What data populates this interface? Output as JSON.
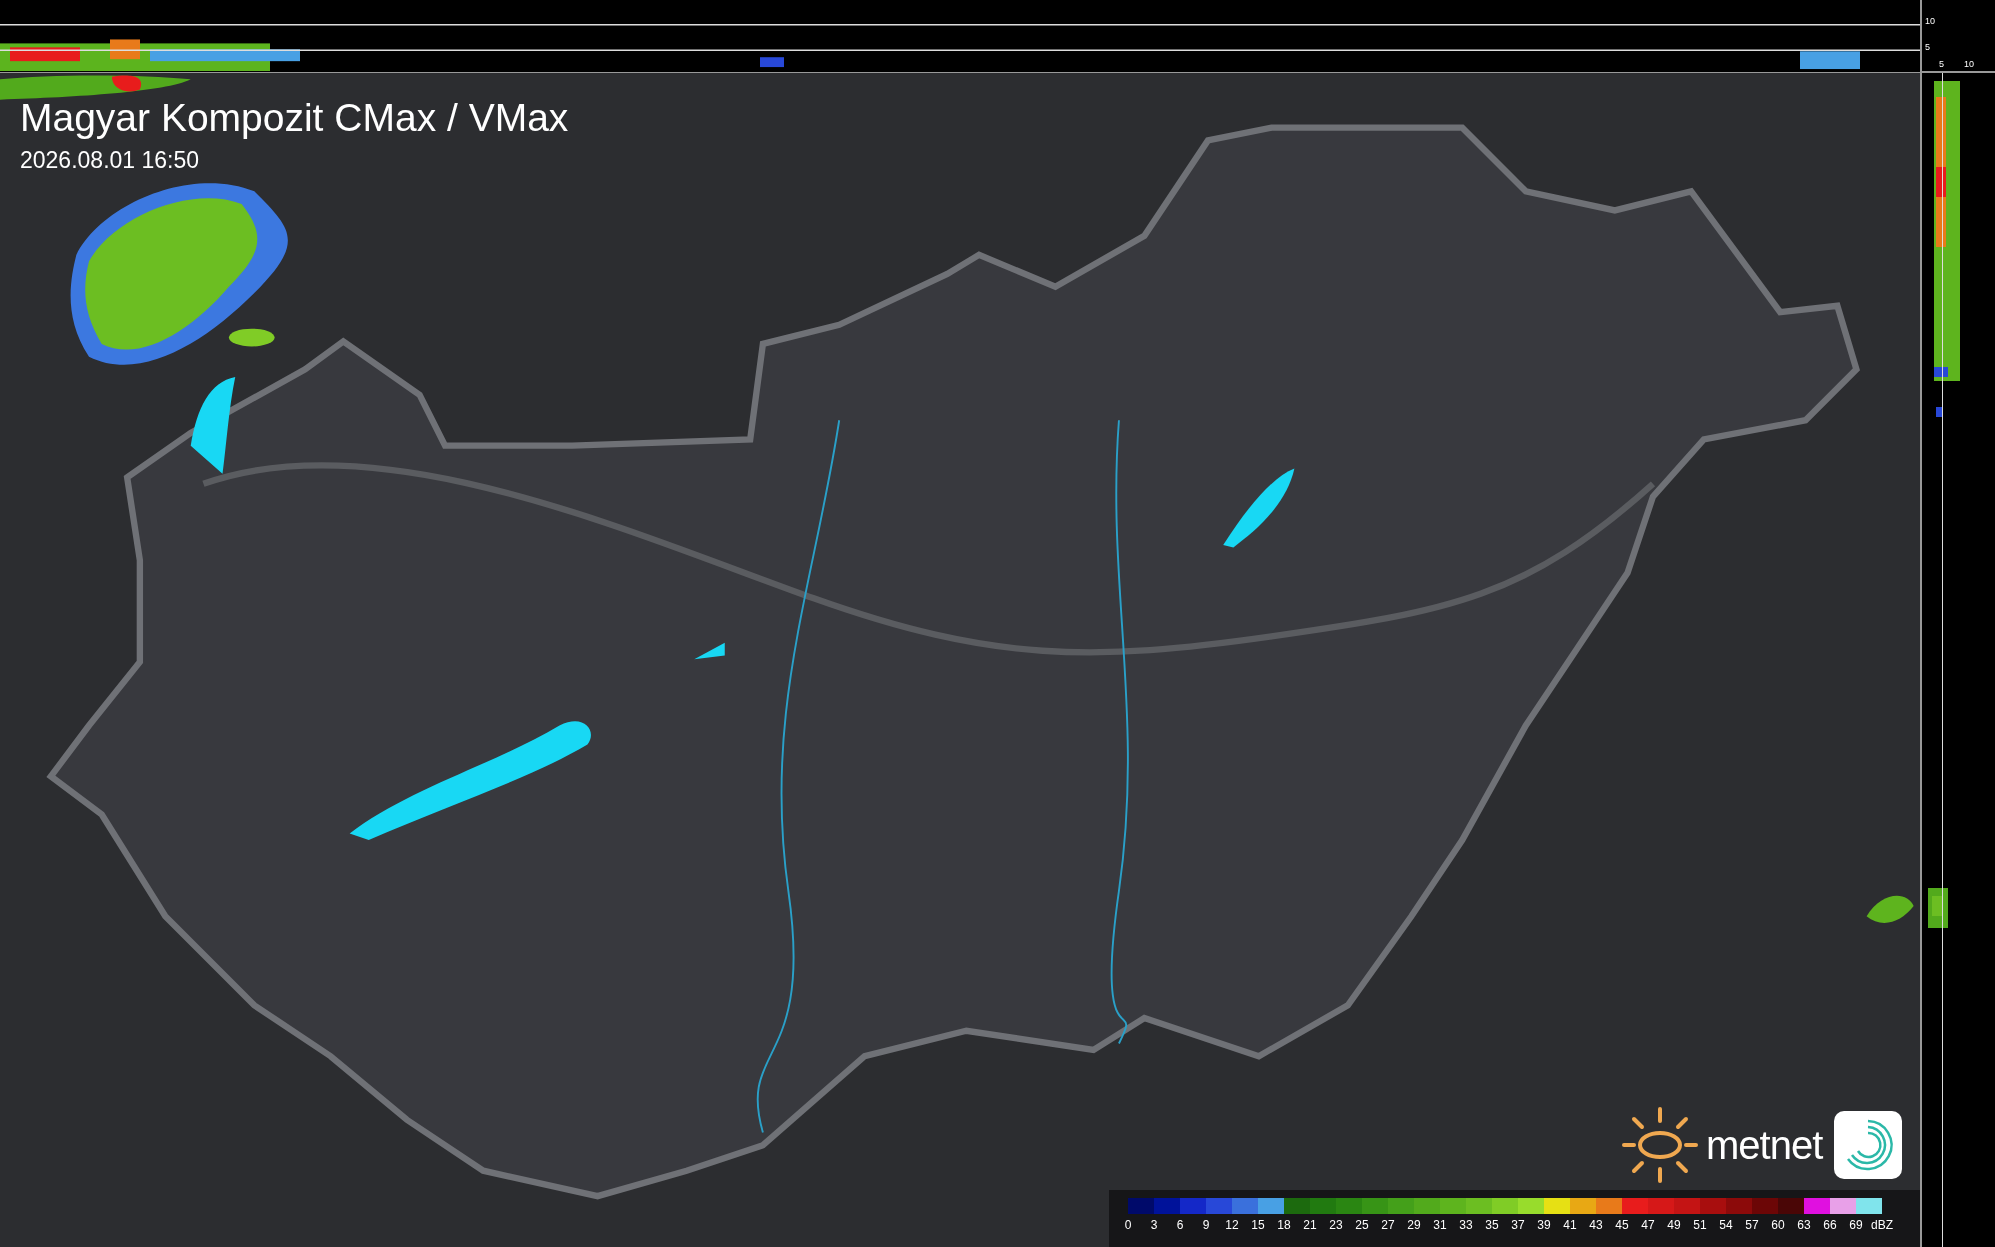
{
  "title": "Magyar Kompozit CMax / VMax",
  "timestamp": "2026.08.01 16:50",
  "side_axes": {
    "top_labels": [
      "10",
      "5"
    ],
    "right_labels": [
      "5",
      "10"
    ]
  },
  "brand": "metnet",
  "legend": {
    "unit": "dBZ",
    "items": [
      {
        "label": "0",
        "color": "#000a6a"
      },
      {
        "label": "3",
        "color": "#00129a"
      },
      {
        "label": "6",
        "color": "#1428c8"
      },
      {
        "label": "9",
        "color": "#2848d8"
      },
      {
        "label": "12",
        "color": "#3a70dc"
      },
      {
        "label": "15",
        "color": "#48a0e4"
      },
      {
        "label": "18",
        "color": "#1c6a0e"
      },
      {
        "label": "21",
        "color": "#217a10"
      },
      {
        "label": "23",
        "color": "#2a8612"
      },
      {
        "label": "25",
        "color": "#379416"
      },
      {
        "label": "27",
        "color": "#44a01a"
      },
      {
        "label": "29",
        "color": "#52aa1c"
      },
      {
        "label": "31",
        "color": "#5eb41e"
      },
      {
        "label": "33",
        "color": "#6cbe22"
      },
      {
        "label": "35",
        "color": "#80cc26"
      },
      {
        "label": "37",
        "color": "#98dc2c"
      },
      {
        "label": "39",
        "color": "#e6e014"
      },
      {
        "label": "41",
        "color": "#e8a814"
      },
      {
        "label": "43",
        "color": "#e87a1a"
      },
      {
        "label": "45",
        "color": "#e81c1c"
      },
      {
        "label": "47",
        "color": "#d61818"
      },
      {
        "label": "49",
        "color": "#c41414"
      },
      {
        "label": "51",
        "color": "#a80e0e"
      },
      {
        "label": "54",
        "color": "#8c0a0a"
      },
      {
        "label": "57",
        "color": "#6c0606"
      },
      {
        "label": "60",
        "color": "#4a0606"
      },
      {
        "label": "63",
        "color": "#e010e0"
      },
      {
        "label": "66",
        "color": "#e8a0e8"
      },
      {
        "label": "69",
        "color": "#80e4ec"
      }
    ]
  }
}
